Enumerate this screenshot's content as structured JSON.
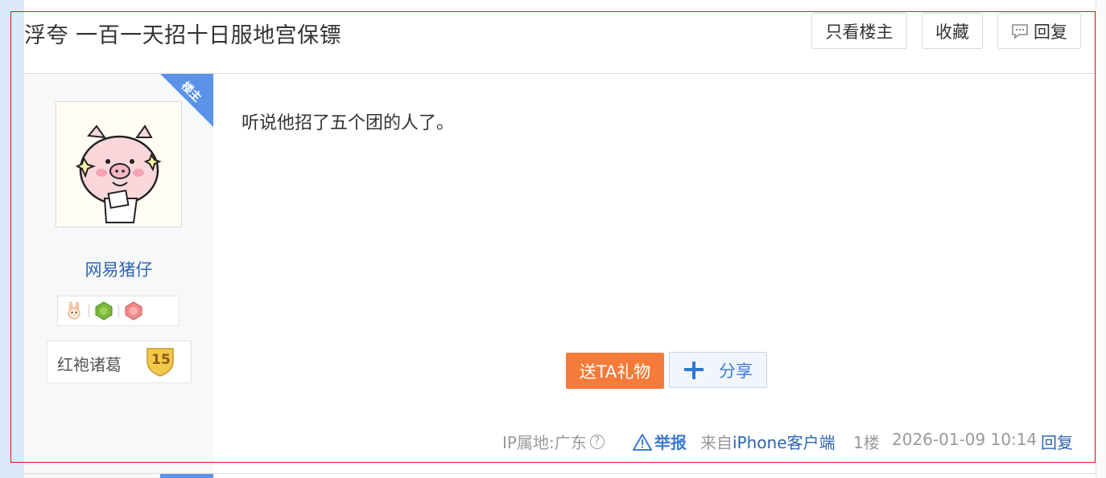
{
  "thread": {
    "title": "浮夸 一百一天招十日服地宫保镖",
    "buttons": {
      "only_op": "只看楼主",
      "favorite": "收藏",
      "reply": "回复"
    }
  },
  "post": {
    "author": {
      "op_badge": "楼主",
      "name": "网易猪仔",
      "level_title": "红袍诸葛",
      "level_number": "15"
    },
    "content": "听说他招了五个团的人了。",
    "actions": {
      "gift": "送TA礼物",
      "share": "分享"
    },
    "footer": {
      "ip": "IP属地:广东",
      "ip_help": "?",
      "report": "举报",
      "from_prefix": "来自",
      "client": "iPhone客户端",
      "floor": "1楼",
      "time": "2026-01-09 10:14",
      "reply": "回复"
    }
  },
  "colors": {
    "accent": "#2d64b3",
    "gift": "#f47b3a",
    "op_corner": "#5a93e8"
  }
}
